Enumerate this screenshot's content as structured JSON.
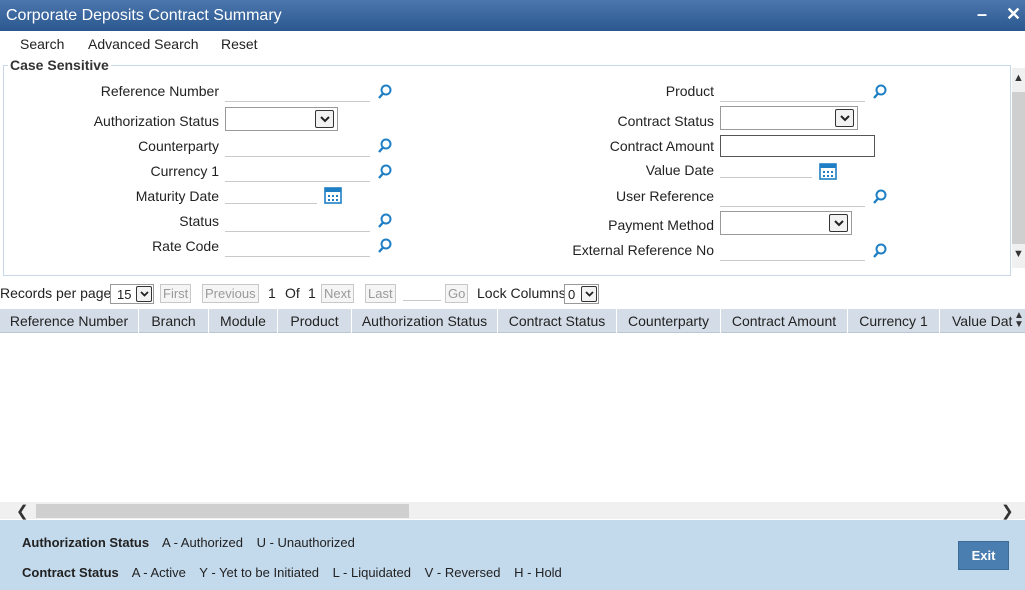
{
  "window": {
    "title": "Corporate Deposits Contract Summary",
    "minimize": "–",
    "close": "✕"
  },
  "toolbar": {
    "search": "Search",
    "advanced_search": "Advanced Search",
    "reset": "Reset"
  },
  "criteria": {
    "legend": "Case Sensitive",
    "left": {
      "reference_number": "Reference Number",
      "authorization_status": "Authorization Status",
      "counterparty": "Counterparty",
      "currency": "Currency 1",
      "maturity_date": "Maturity Date",
      "status": "Status",
      "rate_code": "Rate Code"
    },
    "right": {
      "product": "Product",
      "contract_status": "Contract Status",
      "contract_amount": "Contract Amount",
      "value_date": "Value Date",
      "user_reference": "User Reference",
      "payment_method": "Payment Method",
      "external_reference_no": "External Reference No"
    }
  },
  "pager": {
    "records_per_page_label": "Records per page",
    "records_per_page_value": "15",
    "first": "First",
    "previous": "Previous",
    "current_page": "1",
    "of": "Of",
    "total_pages": "1",
    "next": "Next",
    "last": "Last",
    "go": "Go",
    "lock_columns_label": "Lock Columns",
    "lock_columns_value": "0"
  },
  "grid": {
    "columns": [
      "Reference Number",
      "Branch",
      "Module",
      "Product",
      "Authorization Status",
      "Contract Status",
      "Counterparty",
      "Contract Amount",
      "Currency 1",
      "Value Dat"
    ]
  },
  "legend_footer": {
    "auth_title": "Authorization Status",
    "auth_items": [
      "A - Authorized",
      "U - Unauthorized"
    ],
    "contract_title": "Contract Status",
    "contract_items": [
      "A - Active",
      "Y - Yet to be Initiated",
      "L - Liquidated",
      "V - Reversed",
      "H - Hold"
    ],
    "exit": "Exit"
  },
  "colors": {
    "titlebar": "#2c5790",
    "footer": "#c3d9ec",
    "grid_header": "#d4dde7",
    "exit_button": "#4a7eb0",
    "icon": "#1f7fc4"
  }
}
